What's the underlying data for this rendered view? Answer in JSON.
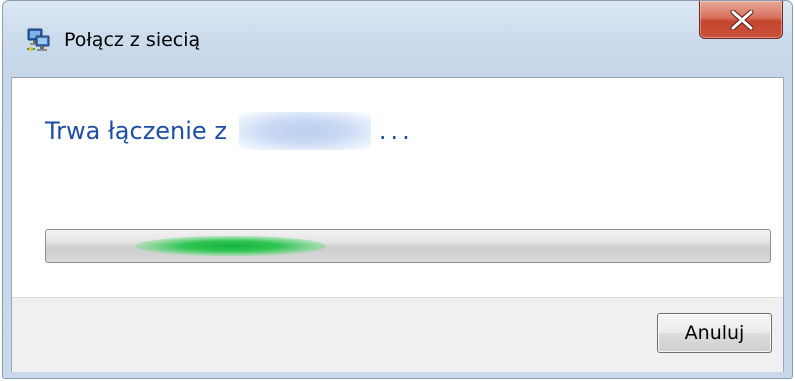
{
  "window": {
    "title": "Połącz z siecią",
    "title_icon": "network-connect-icon",
    "close_icon": "close-icon"
  },
  "main": {
    "heading_prefix": "Trwa łączenie z",
    "network_name_redacted": true,
    "ellipsis": "..."
  },
  "progress": {
    "state": "indeterminate",
    "color": "#1fb53f"
  },
  "footer": {
    "cancel_label": "Anuluj"
  },
  "colors": {
    "heading": "#1e4ea5",
    "close_button": "#c8543a",
    "frame": "#cfdeee"
  }
}
